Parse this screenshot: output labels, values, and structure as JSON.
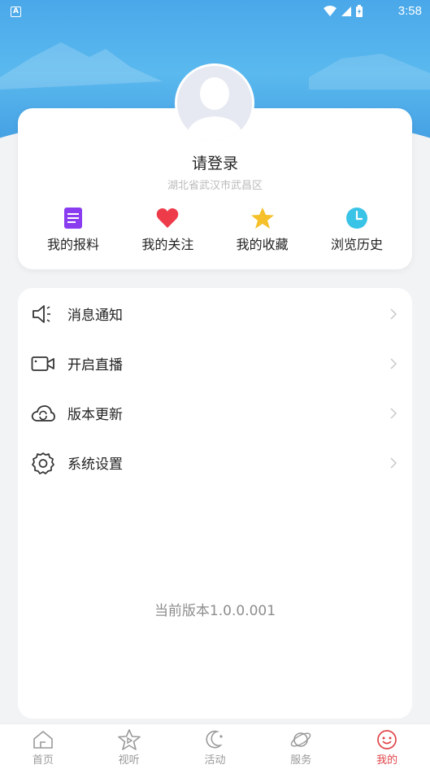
{
  "status_bar": {
    "time": "3:58"
  },
  "profile": {
    "login_text": "请登录",
    "location": "湖北省武汉市武昌区"
  },
  "quick_actions": [
    {
      "label": "我的报料",
      "icon": "document-icon",
      "color": "#8a3cf0"
    },
    {
      "label": "我的关注",
      "icon": "heart-icon",
      "color": "#ee3b4a"
    },
    {
      "label": "我的收藏",
      "icon": "star-icon",
      "color": "#f5c029"
    },
    {
      "label": "浏览历史",
      "icon": "clock-icon",
      "color": "#39c3e6"
    }
  ],
  "menu": [
    {
      "label": "消息通知",
      "icon": "speaker-icon"
    },
    {
      "label": "开启直播",
      "icon": "video-camera-icon"
    },
    {
      "label": "版本更新",
      "icon": "cloud-sync-icon"
    },
    {
      "label": "系统设置",
      "icon": "gear-icon"
    }
  ],
  "version_text": "当前版本1.0.0.001",
  "tabs": [
    {
      "label": "首页",
      "icon": "home-icon",
      "active": false
    },
    {
      "label": "视听",
      "icon": "star-play-icon",
      "active": false
    },
    {
      "label": "活动",
      "icon": "moon-icon",
      "active": false
    },
    {
      "label": "服务",
      "icon": "planet-icon",
      "active": false
    },
    {
      "label": "我的",
      "icon": "smile-icon",
      "active": true
    }
  ],
  "colors": {
    "header": "#4aa8ea",
    "active_tab": "#e0454a"
  }
}
